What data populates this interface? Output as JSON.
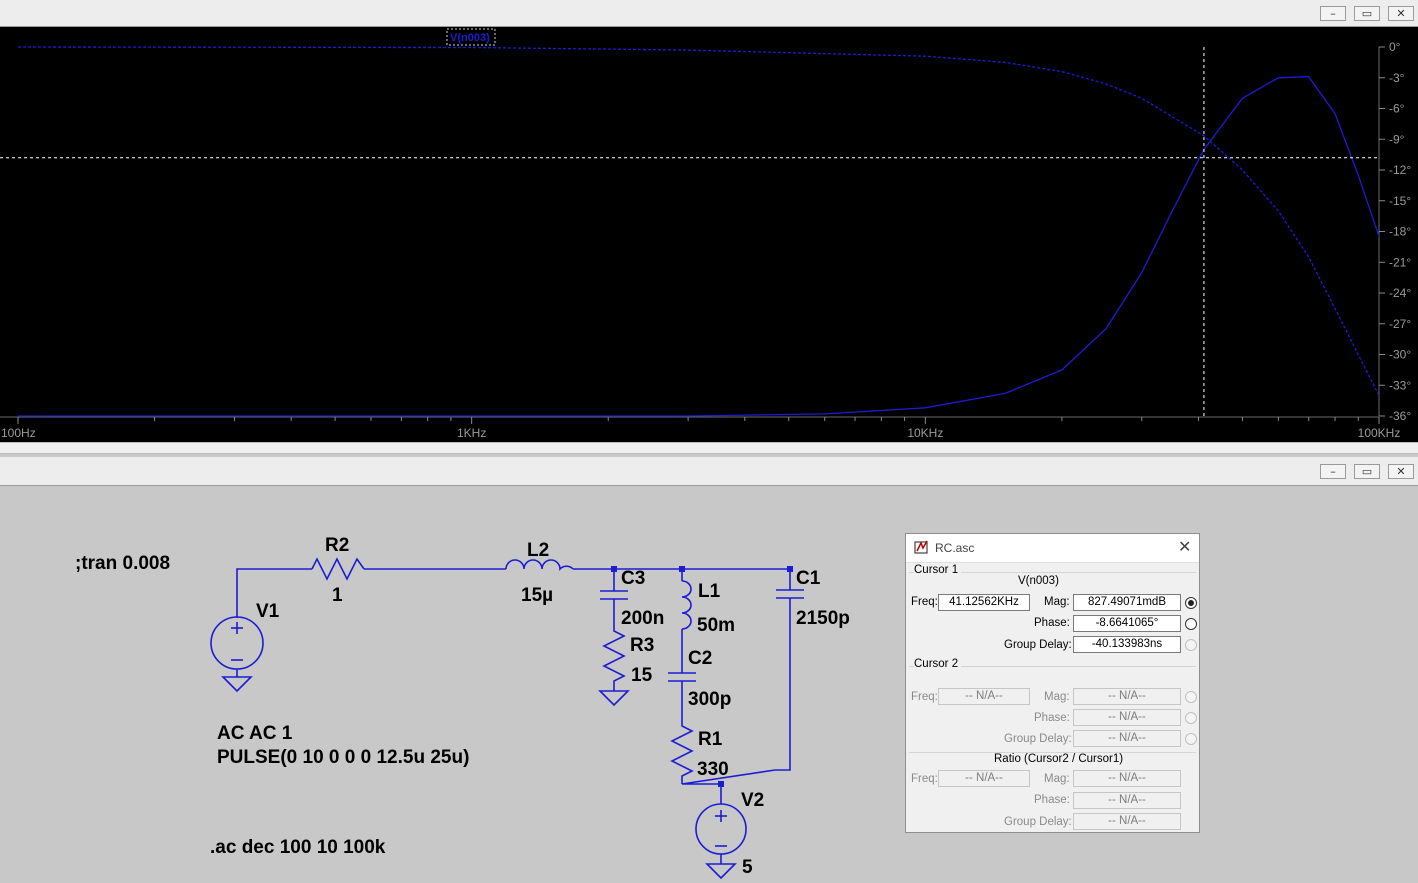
{
  "window_buttons": {
    "minimize": "–",
    "restore": "▭",
    "close": "✕"
  },
  "plot": {
    "trace_label": "V(n003)",
    "trace_color": "#1c1cd4",
    "background": "#000000",
    "x_ticks": [
      "100Hz",
      "1KHz",
      "10KHz",
      "100KHz"
    ],
    "y_ticks": [
      "0°",
      "-3°",
      "-6°",
      "-9°",
      "-12°",
      "-15°",
      "-18°",
      "-21°",
      "-24°",
      "-27°",
      "-30°",
      "-33°",
      "-36°"
    ]
  },
  "chart_data": {
    "type": "line",
    "title": "",
    "x_scale": "log",
    "xlim_hz": [
      100,
      100000
    ],
    "ylim": [
      -36,
      0
    ],
    "y_tick_labels": [
      "0°",
      "-3°",
      "-6°",
      "-9°",
      "-12°",
      "-15°",
      "-18°",
      "-21°",
      "-24°",
      "-27°",
      "-30°",
      "-33°",
      "-36°"
    ],
    "x_tick_labels": [
      "100Hz",
      "1KHz",
      "10KHz",
      "100KHz"
    ],
    "series": [
      {
        "name": "V(n003)",
        "style": "solid",
        "x": [
          100,
          1000,
          3000,
          6000,
          10000,
          15000,
          20000,
          25000,
          30000,
          35000,
          41126,
          50000,
          60000,
          70000,
          80000,
          90000,
          100000
        ],
        "y": [
          -36,
          -36,
          -36,
          -35.8,
          -35.2,
          -33.8,
          -31.5,
          -27.5,
          -22,
          -16,
          -10,
          -5,
          -3,
          -2.9,
          -6.5,
          -12.5,
          -18.5
        ]
      },
      {
        "name": "",
        "style": "dashed",
        "x": [
          100,
          1000,
          3000,
          10000,
          15000,
          20000,
          25000,
          30000,
          35000,
          41126,
          50000,
          60000,
          70000,
          80000,
          90000,
          100000
        ],
        "y": [
          0,
          -0.05,
          -0.3,
          -0.9,
          -1.5,
          -2.4,
          -3.6,
          -5,
          -6.8,
          -8.66,
          -12,
          -16,
          -20.5,
          -25.5,
          -30,
          -34
        ]
      }
    ],
    "cursor": {
      "x": 41126,
      "y": -10.8
    },
    "grid": false
  },
  "schematic": {
    "directive_tran": ";tran 0.008",
    "directive_ac": ".ac dec 100 10 100k",
    "v1_name": "V1",
    "v1_line1": "AC AC 1",
    "v1_line2": "PULSE(0 10 0 0 0 12.5u 25u)",
    "r2_name": "R2",
    "r2_val": "1",
    "l2_name": "L2",
    "l2_val": "15µ",
    "c3_name": "C3",
    "c3_val": "200n",
    "r3_name": "R3",
    "r3_val": "15",
    "l1_name": "L1",
    "l1_val": "50m",
    "c2_name": "C2",
    "c2_val": "300p",
    "r1_name": "R1",
    "r1_val": "330",
    "c1_name": "C1",
    "c1_val": "2150p",
    "v2_name": "V2",
    "v2_val": "5",
    "wire_color": "#1c1cd4"
  },
  "dialog": {
    "title": "RC.asc",
    "cursor1": {
      "group": "Cursor 1",
      "trace": "V(n003)",
      "freq_label": "Freq:",
      "freq": "41.12562KHz",
      "mag_label": "Mag:",
      "mag": "827.49071mdB",
      "phase_label": "Phase:",
      "phase": "-8.6641065°",
      "gd_label": "Group Delay:",
      "gd": "-40.133983ns"
    },
    "cursor2": {
      "group": "Cursor 2",
      "freq_label": "Freq:",
      "freq": "-- N/A--",
      "mag_label": "Mag:",
      "mag": "-- N/A--",
      "phase_label": "Phase:",
      "phase": "-- N/A--",
      "gd_label": "Group Delay:",
      "gd": "-- N/A--"
    },
    "ratio": {
      "group": "Ratio (Cursor2 / Cursor1)",
      "freq_label": "Freq:",
      "freq": "-- N/A--",
      "mag_label": "Mag:",
      "mag": "-- N/A--",
      "phase_label": "Phase:",
      "phase": "-- N/A--",
      "gd_label": "Group Delay:",
      "gd": "-- N/A--"
    }
  }
}
